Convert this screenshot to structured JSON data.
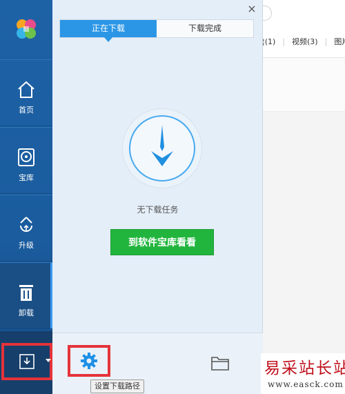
{
  "background_app": {
    "tabs_partial": [
      "¦(1)",
      "视频(3)",
      "图片("
    ]
  },
  "sidebar": {
    "items": [
      {
        "label": "首页",
        "icon": "home-icon"
      },
      {
        "label": "宝库",
        "icon": "disc-icon"
      },
      {
        "label": "升级",
        "icon": "upgrade-icon"
      },
      {
        "label": "卸载",
        "icon": "trash-icon"
      }
    ],
    "active_index": 3
  },
  "download_panel": {
    "close_label": "×",
    "tabs": [
      {
        "label": "正在下载",
        "active": true
      },
      {
        "label": "下载完成",
        "active": false
      }
    ],
    "empty_text": "无下载任务",
    "store_button": "到软件宝库看看",
    "tooltip": "设置下载路径"
  },
  "watermark": {
    "text": "易采站长站",
    "url": "www.easck.com"
  },
  "colors": {
    "sidebar": "#1a5c9e",
    "accent_blue": "#2b96e6",
    "green_button": "#22b53e",
    "highlight_red": "#e5333a"
  }
}
